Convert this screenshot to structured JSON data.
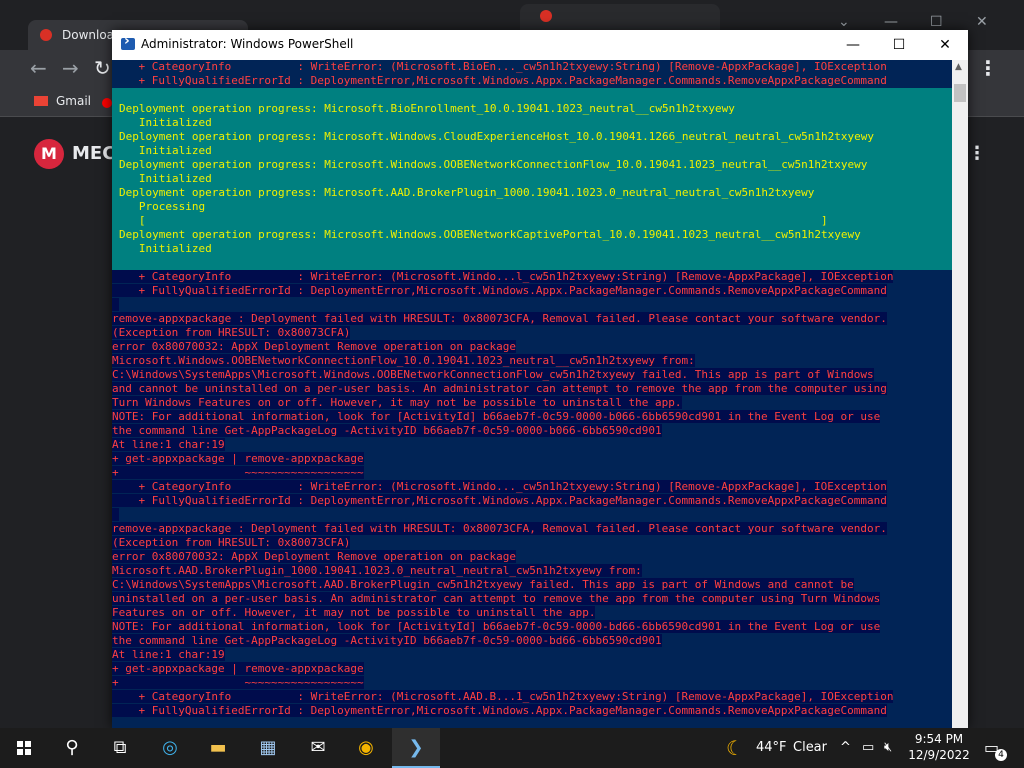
{
  "background_browser": {
    "tab_title": "Downloa",
    "bookmark_gmail": "Gmail",
    "page_logo_letter": "M",
    "page_logo_text": "MEC"
  },
  "powershell": {
    "title": "Administrator: Windows PowerShell",
    "buttons": {
      "minimize": "—",
      "maximize": "☐",
      "close": "✕"
    },
    "top_error_lines": [
      "    + CategoryInfo          : WriteError: (Microsoft.BioEn..._cw5n1h2txyewy:String) [Remove-AppxPackage], IOException",
      "    + FullyQualifiedErrorId : DeploymentError,Microsoft.Windows.Appx.PackageManager.Commands.RemoveAppxPackageCommand"
    ],
    "progress_lines": [
      "Deployment operation progress: Microsoft.BioEnrollment_10.0.19041.1023_neutral__cw5n1h2txyewy",
      "   Initialized",
      "Deployment operation progress: Microsoft.Windows.CloudExperienceHost_10.0.19041.1266_neutral_neutral_cw5n1h2txyewy",
      "   Initialized",
      "Deployment operation progress: Microsoft.Windows.OOBENetworkConnectionFlow_10.0.19041.1023_neutral__cw5n1h2txyewy",
      "   Initialized",
      "Deployment operation progress: Microsoft.AAD.BrokerPlugin_1000.19041.1023.0_neutral_neutral_cw5n1h2txyewy",
      "   Processing",
      "   [                                                                                                      ]",
      "Deployment operation progress: Microsoft.Windows.OOBENetworkCaptivePortal_10.0.19041.1023_neutral__cw5n1h2txyewy",
      "   Initialized"
    ],
    "error_lines": [
      "    + CategoryInfo          : WriteError: (Microsoft.Windo...l_cw5n1h2txyewy:String) [Remove-AppxPackage], IOException",
      "    + FullyQualifiedErrorId : DeploymentError,Microsoft.Windows.Appx.PackageManager.Commands.RemoveAppxPackageCommand",
      " ",
      "remove-appxpackage : Deployment failed with HRESULT: 0x80073CFA, Removal failed. Please contact your software vendor.",
      "(Exception from HRESULT: 0x80073CFA)",
      "error 0x80070032: AppX Deployment Remove operation on package",
      "Microsoft.Windows.OOBENetworkConnectionFlow_10.0.19041.1023_neutral__cw5n1h2txyewy from:",
      "C:\\Windows\\SystemApps\\Microsoft.Windows.OOBENetworkConnectionFlow_cw5n1h2txyewy failed. This app is part of Windows",
      "and cannot be uninstalled on a per-user basis. An administrator can attempt to remove the app from the computer using",
      "Turn Windows Features on or off. However, it may not be possible to uninstall the app.",
      "NOTE: For additional information, look for [ActivityId] b66aeb7f-0c59-0000-b066-6bb6590cd901 in the Event Log or use",
      "the command line Get-AppPackageLog -ActivityID b66aeb7f-0c59-0000-b066-6bb6590cd901",
      "At line:1 char:19",
      "+ get-appxpackage | remove-appxpackage",
      "+                   ~~~~~~~~~~~~~~~~~~",
      "    + CategoryInfo          : WriteError: (Microsoft.Windo..._cw5n1h2txyewy:String) [Remove-AppxPackage], IOException",
      "    + FullyQualifiedErrorId : DeploymentError,Microsoft.Windows.Appx.PackageManager.Commands.RemoveAppxPackageCommand",
      " ",
      "remove-appxpackage : Deployment failed with HRESULT: 0x80073CFA, Removal failed. Please contact your software vendor.",
      "(Exception from HRESULT: 0x80073CFA)",
      "error 0x80070032: AppX Deployment Remove operation on package",
      "Microsoft.AAD.BrokerPlugin_1000.19041.1023.0_neutral_neutral_cw5n1h2txyewy from:",
      "C:\\Windows\\SystemApps\\Microsoft.AAD.BrokerPlugin_cw5n1h2txyewy failed. This app is part of Windows and cannot be",
      "uninstalled on a per-user basis. An administrator can attempt to remove the app from the computer using Turn Windows",
      "Features on or off. However, it may not be possible to uninstall the app.",
      "NOTE: For additional information, look for [ActivityId] b66aeb7f-0c59-0000-bd66-6bb6590cd901 in the Event Log or use",
      "the command line Get-AppPackageLog -ActivityID b66aeb7f-0c59-0000-bd66-6bb6590cd901",
      "At line:1 char:19",
      "+ get-appxpackage | remove-appxpackage",
      "+                   ~~~~~~~~~~~~~~~~~~",
      "    + CategoryInfo          : WriteError: (Microsoft.AAD.B...1_cw5n1h2txyewy:String) [Remove-AppxPackage], IOException",
      "    + FullyQualifiedErrorId : DeploymentError,Microsoft.Windows.Appx.PackageManager.Commands.RemoveAppxPackageCommand"
    ]
  },
  "taskbar": {
    "weather_temp": "44°F",
    "weather_text": "Clear",
    "time": "9:54 PM",
    "date": "12/9/2022",
    "notification_count": "4"
  }
}
